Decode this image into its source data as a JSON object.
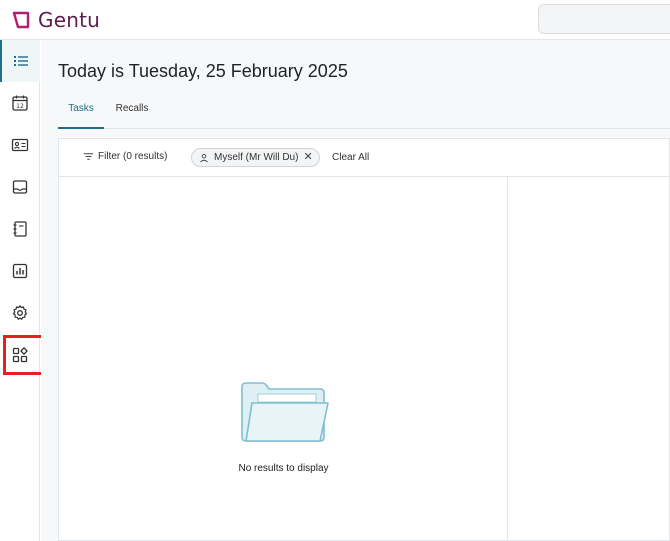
{
  "app": {
    "name": "Gentu"
  },
  "sidebar": {
    "items": [
      {
        "name": "task-list",
        "icon": "list-icon",
        "active": true
      },
      {
        "name": "appointments",
        "icon": "calendar-icon",
        "label": "12"
      },
      {
        "name": "patients",
        "icon": "id-card-icon"
      },
      {
        "name": "inbox",
        "icon": "inbox-icon"
      },
      {
        "name": "notebook",
        "icon": "notebook-icon"
      },
      {
        "name": "reports",
        "icon": "chart-icon"
      },
      {
        "name": "settings",
        "icon": "gear-icon"
      },
      {
        "name": "apps",
        "icon": "apps-icon",
        "highlighted": true
      }
    ]
  },
  "main": {
    "title": "Today is Tuesday, 25 February 2025",
    "tabs": [
      {
        "label": "Tasks",
        "active": true
      },
      {
        "label": "Recalls",
        "active": false
      }
    ],
    "filter": {
      "label": "Filter (0 results)",
      "chip": "Myself (Mr Will Du)",
      "clear_all": "Clear All"
    },
    "empty_message": "No results to display"
  },
  "colors": {
    "brand": "#5b1f4f",
    "accent": "#1f6f8b",
    "highlight": "#e32120"
  }
}
